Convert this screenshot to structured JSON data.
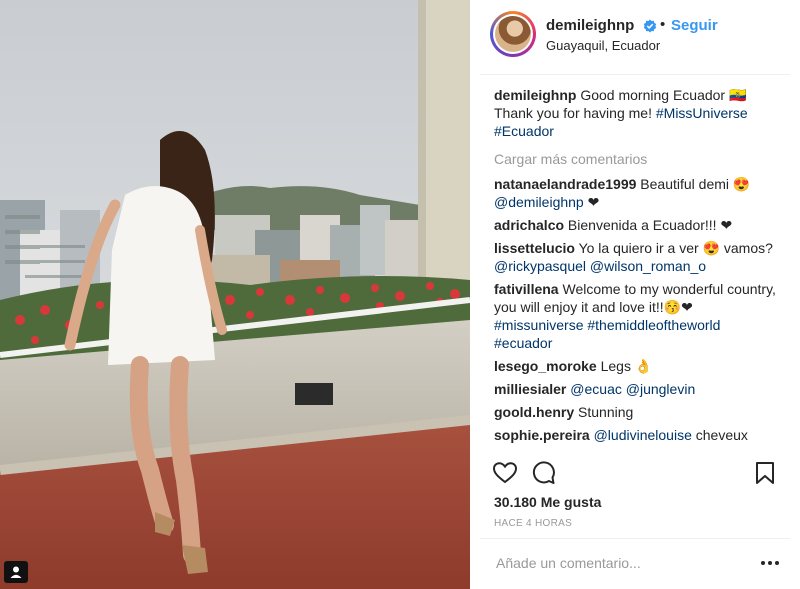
{
  "post": {
    "username": "demileighnp",
    "follow_label": "Seguir",
    "separator": "•",
    "location": "Guayaquil, Ecuador",
    "caption": {
      "username": "demileighnp",
      "text": "Good morning Ecuador 🇪🇨 Thank you for having me!",
      "hashtags": [
        "#MissUniverse",
        "#Ecuador"
      ]
    },
    "load_more_label": "Cargar más comentarios",
    "comments": [
      {
        "username": "natanaelandrade1999",
        "text": "Beautiful demi 😍",
        "tags": [
          "@demileighnp"
        ],
        "suffix": "❤"
      },
      {
        "username": "adrichalco",
        "text": "Bienvenida a Ecuador!!! ❤",
        "tags": [],
        "suffix": ""
      },
      {
        "username": "lissettelucio",
        "text": "Yo la quiero ir a ver 😍 vamos?",
        "tags": [
          "@rickypasquel",
          "@wilson_roman_o"
        ],
        "suffix": ""
      },
      {
        "username": "fativillena",
        "text": "Welcome to my wonderful country, you will enjoy it and love it!!😚❤",
        "tags": [
          "#missuniverse",
          "#themiddleoftheworld",
          "#ecuador"
        ],
        "suffix": ""
      },
      {
        "username": "lesego_moroke",
        "text": "Legs 👌",
        "tags": [],
        "suffix": ""
      },
      {
        "username": "milliesialer",
        "text": "",
        "tags": [
          "@ecuac",
          "@junglevin"
        ],
        "suffix": ""
      },
      {
        "username": "goold.henry",
        "text": "Stunning",
        "tags": [],
        "suffix": ""
      },
      {
        "username": "sophie.pereira",
        "text": "",
        "tags": [
          "@ludivinelouise"
        ],
        "suffix": "cheveux"
      }
    ],
    "likes": "30.180 Me gusta",
    "time_ago": "HACE 4 HORAS",
    "add_comment_placeholder": "Añade un comentario...",
    "icons": {
      "like": "heart-icon",
      "comment": "comment-bubble-icon",
      "save": "bookmark-icon",
      "options": "ellipsis-icon",
      "verified": "verified-badge-icon",
      "tagged": "user-tag-icon"
    },
    "colors": {
      "link": "#003569",
      "follow": "#3897f0",
      "verified": "#3897f0",
      "muted": "#999999"
    }
  }
}
